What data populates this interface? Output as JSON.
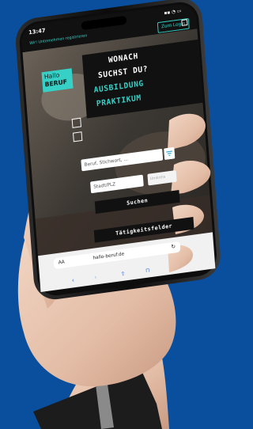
{
  "status_bar": {
    "time": "13:47",
    "indicators": "▪▪ ◔ ▭"
  },
  "top_bar": {
    "company_link": "Wir! Unternehmen registrieren",
    "login_label": "Zum Login"
  },
  "logo": {
    "line1": "Hallo",
    "line2": "BERUF"
  },
  "headline": {
    "line1": "WONACH",
    "line2": "SUCHST DU?",
    "line3": "AUSBILDUNG",
    "line4": "PRAKTIKUM"
  },
  "search": {
    "keyword_placeholder": "Beruf, Stichwort, …",
    "location_placeholder": "Stadt/PLZ",
    "radius_label": "Umkreis",
    "search_button": "Suchen",
    "fields_button": "Tätigkeitsfelder"
  },
  "browser": {
    "text_size": "AA",
    "url": "hallo-beruf.de",
    "reload": "↻"
  },
  "colors": {
    "background": "#0a4f9e",
    "accent": "#37d0c6",
    "dark": "#111111",
    "skin": "#e9c8b4"
  },
  "icons": [
    "filter-icon",
    "lock-icon",
    "reload-icon",
    "share-icon",
    "bookmark-icon",
    "tabs-icon",
    "back-icon",
    "forward-icon"
  ]
}
